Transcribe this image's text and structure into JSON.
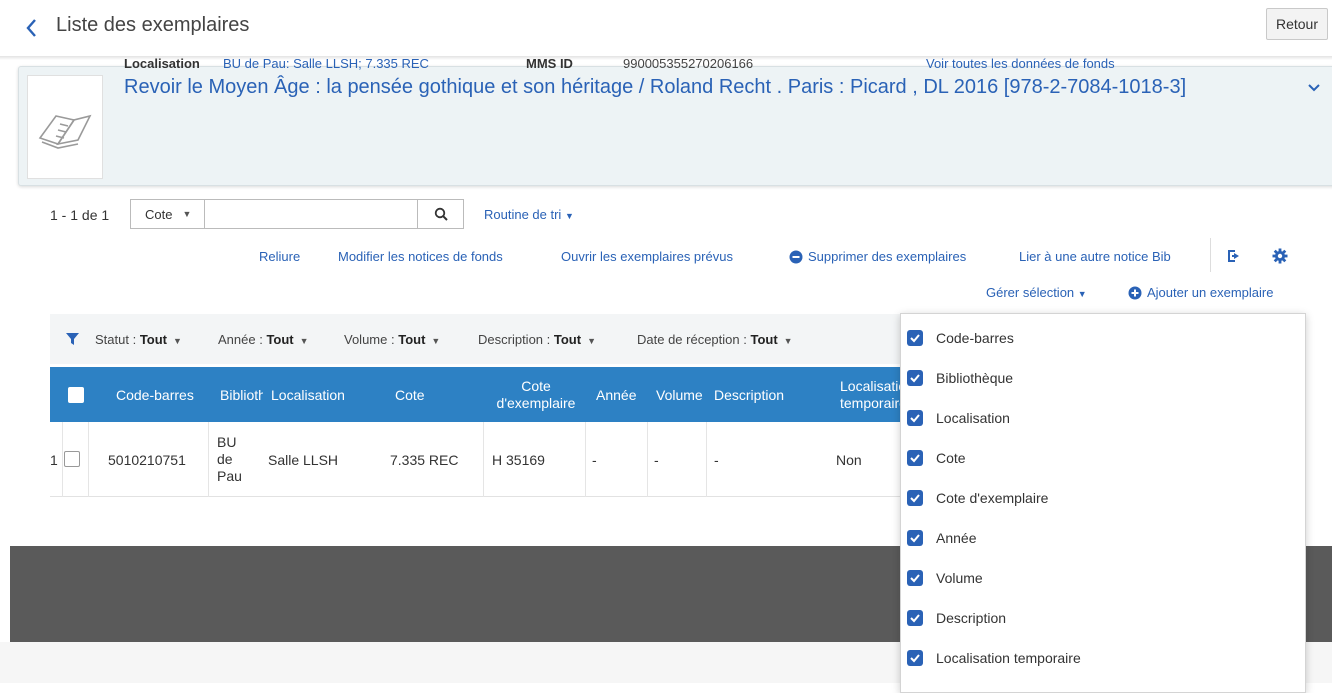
{
  "header": {
    "title": "Liste des exemplaires",
    "back_button_label": "Retour"
  },
  "record": {
    "title": "Revoir le Moyen Âge : la pensée gothique et son héritage / Roland Recht . Paris : Picard , DL 2016 [978-2-7084-1018-3]",
    "localisation_label": "Localisation",
    "localisation_value": "BU de Pau: Salle LLSH; 7.335 REC",
    "mms_label": "MMS ID",
    "mms_value": "990005355270206166",
    "holdings_link": "Voir toutes les données de fonds"
  },
  "search": {
    "range": "1 - 1 de 1",
    "field": "Cote",
    "query": "",
    "sort_label": "Routine de tri"
  },
  "actions": {
    "reliure": "Reliure",
    "modifier": "Modifier les notices de fonds",
    "ouvrir": "Ouvrir les exemplaires prévus",
    "supprimer": "Supprimer des exemplaires",
    "lier": "Lier à une autre notice Bib",
    "gerer": "Gérer sélection",
    "ajouter": "Ajouter un exemplaire"
  },
  "filters": [
    {
      "label": "Statut :",
      "value": "Tout"
    },
    {
      "label": "Année :",
      "value": "Tout"
    },
    {
      "label": "Volume :",
      "value": "Tout"
    },
    {
      "label": "Description :",
      "value": "Tout"
    },
    {
      "label": "Date de réception :",
      "value": "Tout"
    }
  ],
  "table": {
    "headers": {
      "barcode": "Code-barres",
      "library": "Bibliothèque",
      "location": "Localisation",
      "cote": "Cote",
      "cote_line1": "Cote",
      "cote_line2": "d'exemplaire",
      "year": "Année",
      "volume": "Volume",
      "description": "Description",
      "temp_line1": "Localisation",
      "temp_line2": "temporaire"
    },
    "rows": [
      {
        "index": "1",
        "barcode": "5010210751",
        "library_l1": "BU",
        "library_l2": "de",
        "library_l3": "Pau",
        "location": "Salle LLSH",
        "cote": "7.335 REC",
        "item_cote": "H 35169",
        "year": "-",
        "volume": "-",
        "description": "-",
        "temp": "Non"
      }
    ]
  },
  "column_chooser": {
    "items": [
      {
        "label": "Code-barres",
        "checked": true
      },
      {
        "label": "Bibliothèque",
        "checked": true
      },
      {
        "label": "Localisation",
        "checked": true
      },
      {
        "label": "Cote",
        "checked": true
      },
      {
        "label": "Cote d'exemplaire",
        "checked": true
      },
      {
        "label": "Année",
        "checked": true
      },
      {
        "label": "Volume",
        "checked": true
      },
      {
        "label": "Description",
        "checked": true
      },
      {
        "label": "Localisation temporaire",
        "checked": true
      }
    ]
  },
  "colors": {
    "link": "#2a62b6",
    "table_header": "#2d81c4",
    "footer": "#5a5a5a"
  }
}
